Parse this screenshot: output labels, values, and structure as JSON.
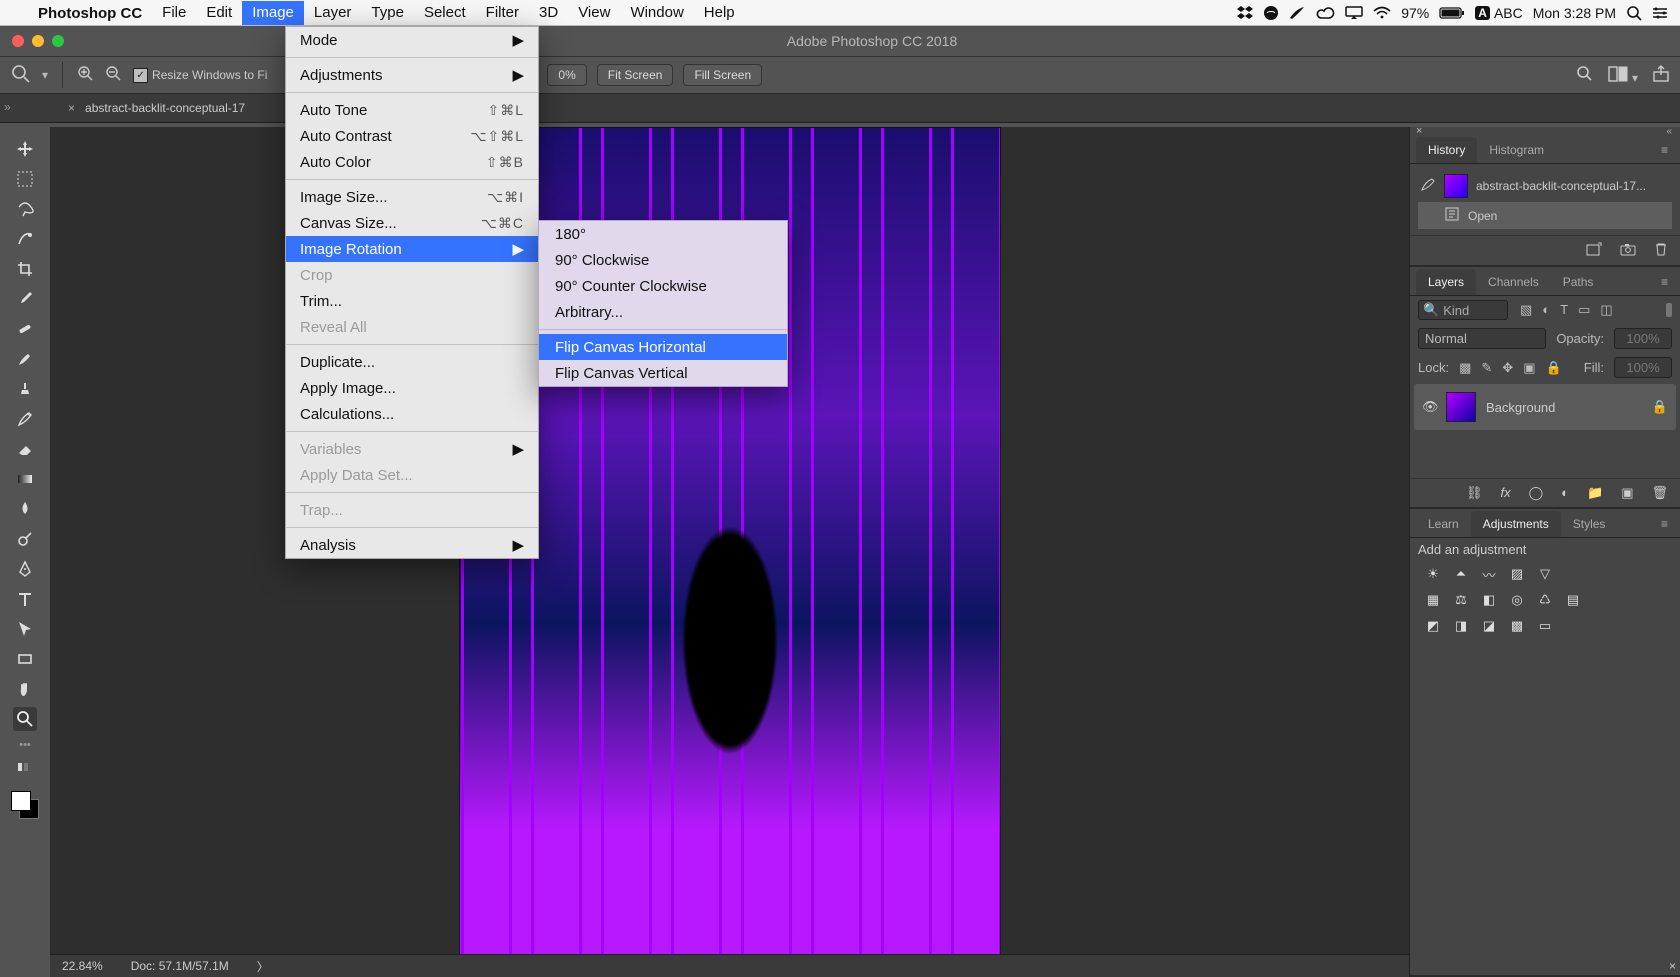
{
  "mac_menu": {
    "app_name": "Photoshop CC",
    "items": [
      "File",
      "Edit",
      "Image",
      "Layer",
      "Type",
      "Select",
      "Filter",
      "3D",
      "View",
      "Window",
      "Help"
    ],
    "selected": "Image",
    "battery": "97%",
    "input": "ABC",
    "clock": "Mon 3:28 PM"
  },
  "window_title": "Adobe Photoshop CC 2018",
  "options_bar": {
    "resize_check_label": "Resize Windows to Fi",
    "zoom_value": "0%",
    "fit_screen": "Fit Screen",
    "fill_screen": "Fill Screen"
  },
  "doc_tab": "abstract-backlit-conceptual-17",
  "image_menu": {
    "items": [
      {
        "label": "Mode",
        "arrow": true
      },
      {
        "sep": true
      },
      {
        "label": "Adjustments",
        "arrow": true
      },
      {
        "sep": true
      },
      {
        "label": "Auto Tone",
        "accel": "⇧⌘L"
      },
      {
        "label": "Auto Contrast",
        "accel": "⌥⇧⌘L"
      },
      {
        "label": "Auto Color",
        "accel": "⇧⌘B"
      },
      {
        "sep": true
      },
      {
        "label": "Image Size...",
        "accel": "⌥⌘I"
      },
      {
        "label": "Canvas Size...",
        "accel": "⌥⌘C"
      },
      {
        "label": "Image Rotation",
        "arrow": true,
        "selected": true
      },
      {
        "label": "Crop",
        "disabled": true
      },
      {
        "label": "Trim..."
      },
      {
        "label": "Reveal All",
        "disabled": true
      },
      {
        "sep": true
      },
      {
        "label": "Duplicate..."
      },
      {
        "label": "Apply Image..."
      },
      {
        "label": "Calculations..."
      },
      {
        "sep": true
      },
      {
        "label": "Variables",
        "arrow": true,
        "disabled": true
      },
      {
        "label": "Apply Data Set...",
        "disabled": true
      },
      {
        "sep": true
      },
      {
        "label": "Trap...",
        "disabled": true
      },
      {
        "sep": true
      },
      {
        "label": "Analysis",
        "arrow": true
      }
    ]
  },
  "rotation_submenu": {
    "items": [
      {
        "label": "180°"
      },
      {
        "label": "90° Clockwise"
      },
      {
        "label": "90° Counter Clockwise"
      },
      {
        "label": "Arbitrary..."
      },
      {
        "sep": true
      },
      {
        "label": "Flip Canvas Horizontal",
        "selected": true
      },
      {
        "label": "Flip Canvas Vertical"
      }
    ]
  },
  "status": {
    "zoom": "22.84%",
    "doc": "Doc: 57.1M/57.1M"
  },
  "panels": {
    "history": {
      "tabs": [
        "History",
        "Histogram"
      ],
      "active": "History",
      "doc_name": "abstract-backlit-conceptual-17...",
      "step": "Open"
    },
    "layers": {
      "tabs": [
        "Layers",
        "Channels",
        "Paths"
      ],
      "active": "Layers",
      "filter_kind": "Kind",
      "blend_mode": "Normal",
      "opacity_label": "Opacity:",
      "opacity_value": "100%",
      "lock_label": "Lock:",
      "fill_label": "Fill:",
      "fill_value": "100%",
      "layer_name": "Background"
    },
    "adjustments": {
      "tabs": [
        "Learn",
        "Adjustments",
        "Styles"
      ],
      "active": "Adjustments",
      "heading": "Add an adjustment"
    }
  }
}
